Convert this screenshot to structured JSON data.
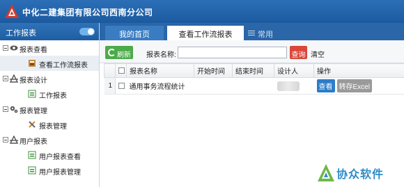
{
  "header": {
    "title": "中化二建集团有限公司西南分公司"
  },
  "sidebar": {
    "title": "工作报表",
    "groups": [
      {
        "label": "报表查看",
        "icon": "eye-icon",
        "children": [
          {
            "label": "查看工作流报表",
            "icon": "report-view-icon",
            "active": true
          }
        ]
      },
      {
        "label": "报表设计",
        "icon": "design-icon",
        "children": [
          {
            "label": "工作报表",
            "icon": "report-icon"
          }
        ]
      },
      {
        "label": "报表管理",
        "icon": "gears-icon",
        "children": [
          {
            "label": "报表管理",
            "icon": "tools-icon"
          }
        ]
      },
      {
        "label": "用户报表",
        "icon": "design-icon",
        "children": [
          {
            "label": "用户报表查看",
            "icon": "report-icon"
          },
          {
            "label": "用户报表管理",
            "icon": "report-icon"
          }
        ]
      }
    ]
  },
  "tabs": {
    "home": "我的首页",
    "active": "查看工作流报表",
    "common": "常用"
  },
  "toolbar": {
    "refresh": "刷新",
    "search_label": "报表名称:",
    "search_value": "",
    "query": "查询",
    "clear": "清空"
  },
  "table": {
    "columns": [
      "报表名称",
      "开始时间",
      "结束时间",
      "设计人",
      "操作"
    ],
    "rows": [
      {
        "num": "1",
        "name": "通用事务流程统计",
        "start": "",
        "end": "",
        "designer": "",
        "view": "查看",
        "excel": "转存Excel"
      }
    ]
  },
  "watermark": {
    "text": "协众软件"
  },
  "colors": {
    "header": "#1f5da2",
    "refresh": "#4bab49",
    "query": "#d9483b",
    "view": "#2d7cc9"
  }
}
